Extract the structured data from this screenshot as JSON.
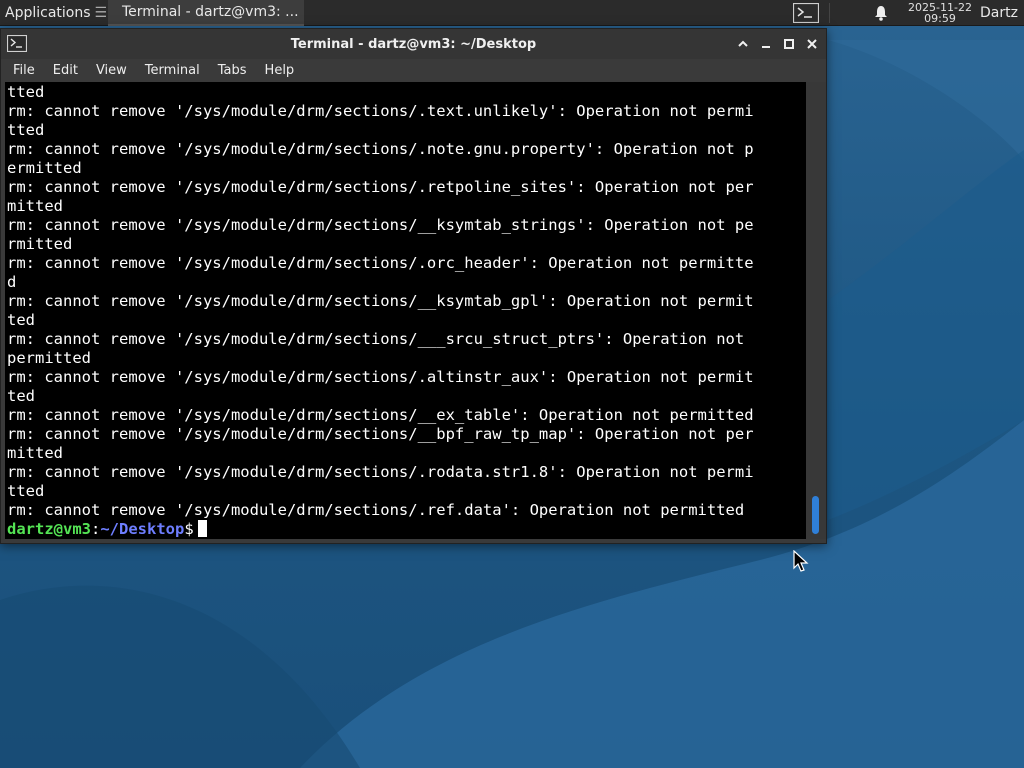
{
  "panel": {
    "apps_label": "Applications",
    "task_title": "Terminal - dartz@vm3: ...",
    "clock_date": "2025-11-22",
    "clock_time": "09:59",
    "user_label": "Dartz"
  },
  "window": {
    "title": "Terminal - dartz@vm3: ~/Desktop"
  },
  "menu": [
    "File",
    "Edit",
    "View",
    "Terminal",
    "Tabs",
    "Help"
  ],
  "terminal": {
    "lines": [
      "tted",
      "rm: cannot remove '/sys/module/drm/sections/.text.unlikely': Operation not permi",
      "tted",
      "rm: cannot remove '/sys/module/drm/sections/.note.gnu.property': Operation not p",
      "ermitted",
      "rm: cannot remove '/sys/module/drm/sections/.retpoline_sites': Operation not per",
      "mitted",
      "rm: cannot remove '/sys/module/drm/sections/__ksymtab_strings': Operation not pe",
      "rmitted",
      "rm: cannot remove '/sys/module/drm/sections/.orc_header': Operation not permitte",
      "d",
      "rm: cannot remove '/sys/module/drm/sections/__ksymtab_gpl': Operation not permit",
      "ted",
      "rm: cannot remove '/sys/module/drm/sections/___srcu_struct_ptrs': Operation not",
      "permitted",
      "rm: cannot remove '/sys/module/drm/sections/.altinstr_aux': Operation not permit",
      "ted",
      "rm: cannot remove '/sys/module/drm/sections/__ex_table': Operation not permitted",
      "rm: cannot remove '/sys/module/drm/sections/__bpf_raw_tp_map': Operation not per",
      "mitted",
      "rm: cannot remove '/sys/module/drm/sections/.rodata.str1.8': Operation not permi",
      "tted",
      "rm: cannot remove '/sys/module/drm/sections/.ref.data': Operation not permitted"
    ],
    "prompt_user": "dartz@vm3",
    "prompt_colon": ":",
    "prompt_path": "~/Desktop",
    "prompt_symbol": "$"
  },
  "colors": {
    "prompt_user": "#54e354",
    "prompt_path": "#6e7eff",
    "scroll_thumb": "#2f7fd8",
    "desktop": "#1f5680"
  },
  "icons": [
    "xfce-logo-icon",
    "terminal-icon",
    "bell-icon",
    "maximize-icon",
    "minimize-icon",
    "restore-icon",
    "close-icon",
    "mouse-pointer-icon"
  ]
}
